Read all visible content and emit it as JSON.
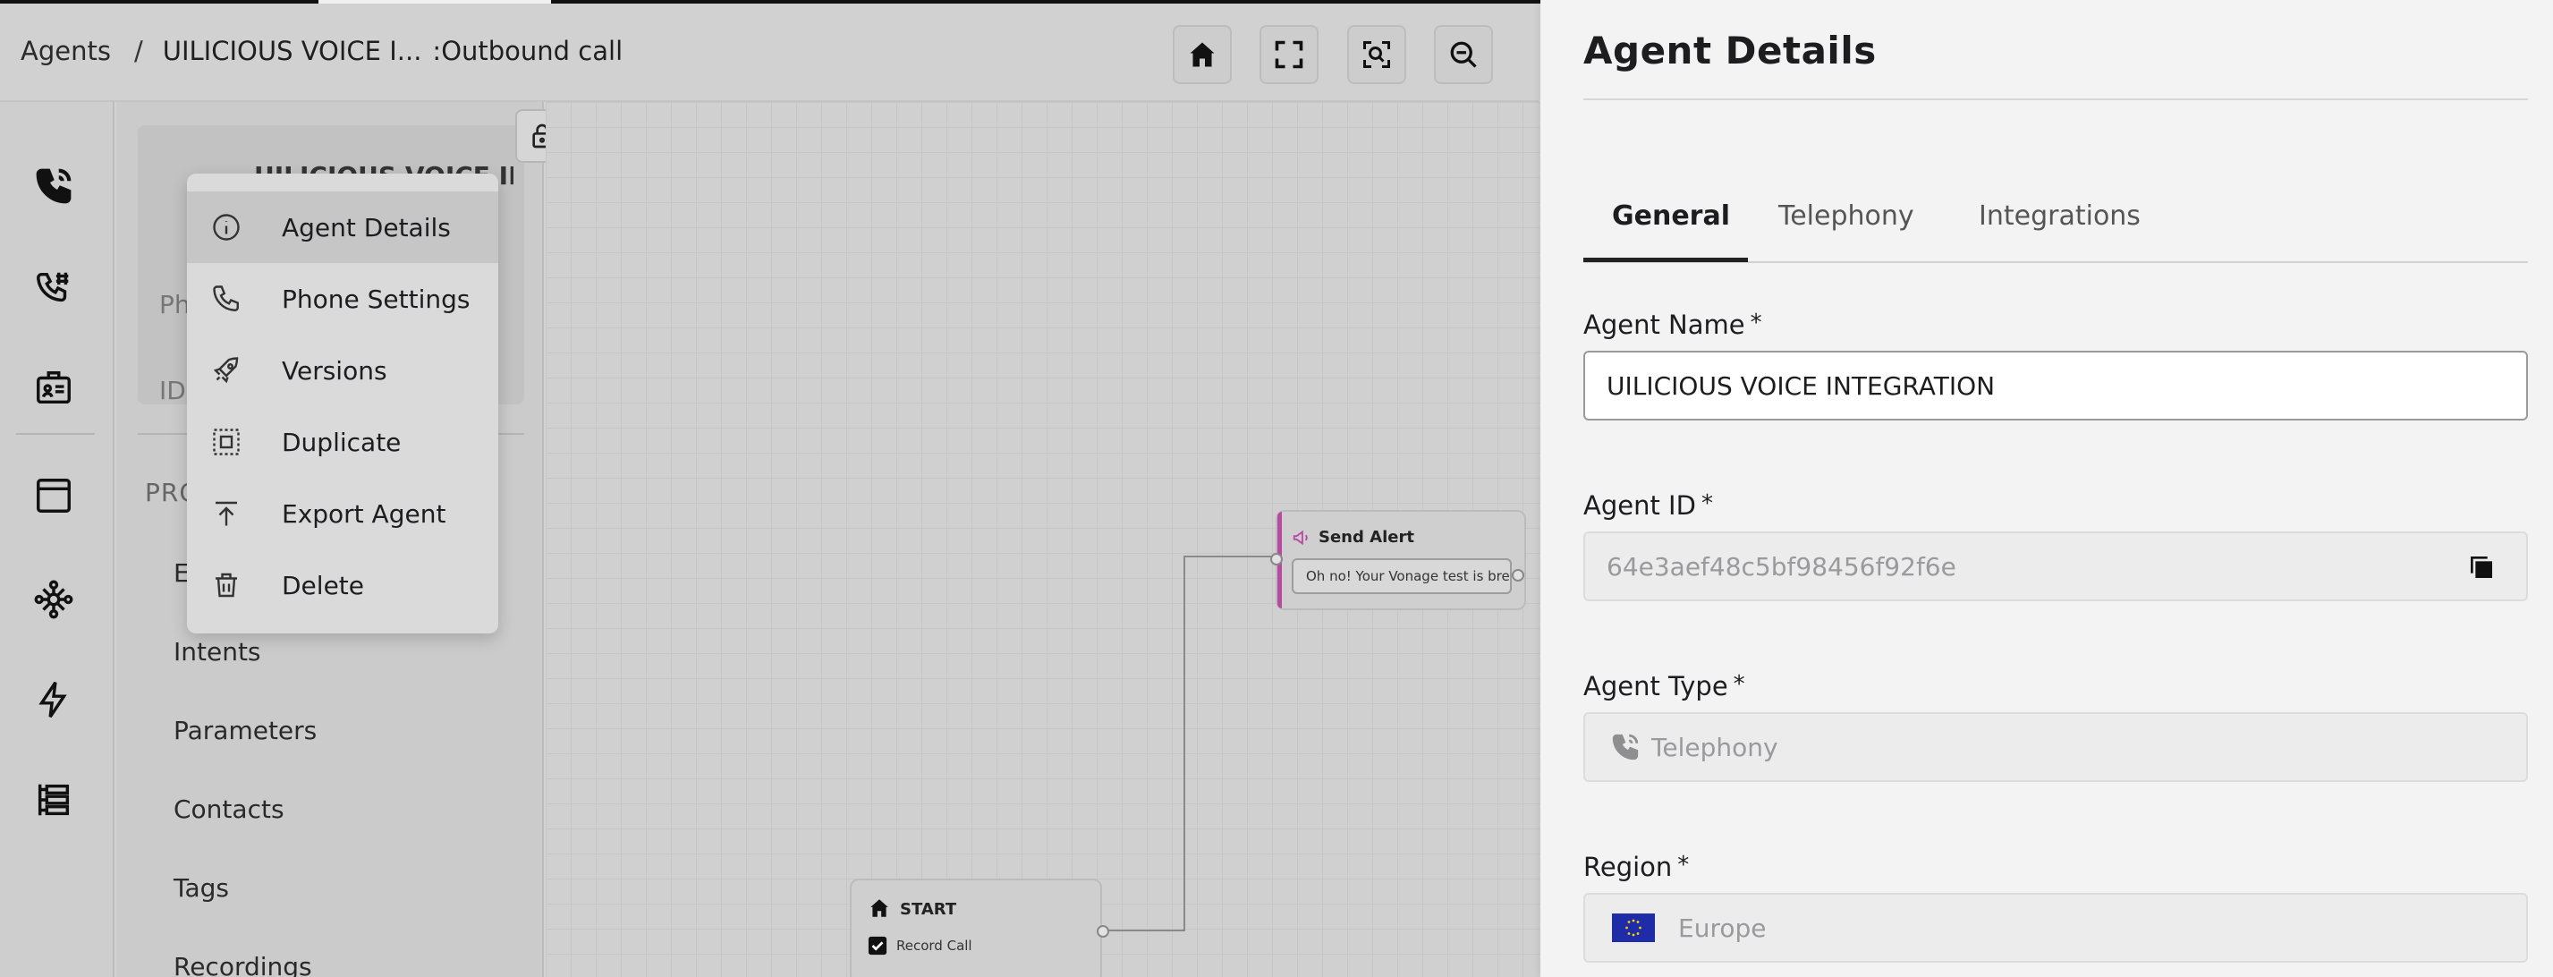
{
  "breadcrumb": {
    "root": "Agents",
    "separator": "/",
    "agent": "UILICIOUS VOICE I...",
    "flow": ":Outbound call"
  },
  "toolbar": {
    "icons": [
      "home-icon",
      "fullscreen-icon",
      "zoom-fit-icon",
      "zoom-out-icon"
    ]
  },
  "rail": {
    "icons": [
      "phone-call-icon",
      "phone-hash-icon",
      "id-card-icon",
      "window-icon",
      "network-icon",
      "lightning-icon",
      "tree-icon"
    ]
  },
  "panel": {
    "agent_title": "UILICIOUS VOICE INT...",
    "phone_label": "Ph",
    "id_label": "ID:",
    "section_label": "PRO",
    "nav_items": [
      "E",
      "Intents",
      "Parameters",
      "Contacts",
      "Tags",
      "Recordings"
    ]
  },
  "menu": {
    "items": [
      {
        "label": "Agent Details",
        "icon": "info-icon"
      },
      {
        "label": "Phone Settings",
        "icon": "phone-icon"
      },
      {
        "label": "Versions",
        "icon": "rocket-icon"
      },
      {
        "label": "Duplicate",
        "icon": "duplicate-icon"
      },
      {
        "label": "Export Agent",
        "icon": "export-icon"
      },
      {
        "label": "Delete",
        "icon": "trash-icon"
      }
    ]
  },
  "canvas": {
    "alert_node": {
      "title": "Send Alert",
      "message": "Oh no! Your Vonage test is brea..."
    },
    "start_node": {
      "title": "START",
      "action": "Record Call"
    }
  },
  "drawer": {
    "title": "Agent Details",
    "tabs": [
      "General",
      "Telephony",
      "Integrations"
    ],
    "active_tab": "General",
    "fields": {
      "name_label": "Agent Name",
      "name_value": "UILICIOUS VOICE INTEGRATION",
      "id_label": "Agent ID",
      "id_value": "64e3aef48c5bf98456f92f6e",
      "type_label": "Agent Type",
      "type_value": "Telephony",
      "region_label": "Region",
      "region_value": "Europe",
      "required_mark": "*"
    }
  },
  "colors": {
    "accent_alert": "#b94aa4",
    "flag_blue": "#1f2ca8",
    "flag_stars": "#f5d400"
  }
}
